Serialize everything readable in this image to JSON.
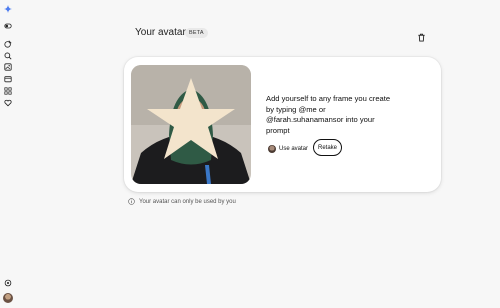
{
  "header": {
    "title": "Your avatar",
    "badge": "BETA"
  },
  "sidebar": {
    "items": [
      {
        "icon": "sparkle-logo-icon"
      },
      {
        "icon": "toggle-sidebar-icon"
      },
      {
        "icon": "new-chat-icon"
      },
      {
        "icon": "search-icon"
      },
      {
        "icon": "image-library-icon"
      },
      {
        "icon": "folder-icon"
      },
      {
        "icon": "apps-grid-icon"
      },
      {
        "icon": "heart-icon"
      },
      {
        "icon": "settings-icon"
      },
      {
        "icon": "user-avatar"
      }
    ]
  },
  "card": {
    "prompt_text": "Add yourself to any frame you create by typing @me or @farah.suhanamansor into your prompt",
    "use_avatar_label": "Use avatar",
    "retake_label": "Retake"
  },
  "footer_note": {
    "icon": "info-icon",
    "text": "Your avatar can only be used by you"
  },
  "colors": {
    "background": "#f7f7f7",
    "card": "#ffffff",
    "accent_blue": "#4d7cf0",
    "star": "#f3e4cc"
  }
}
